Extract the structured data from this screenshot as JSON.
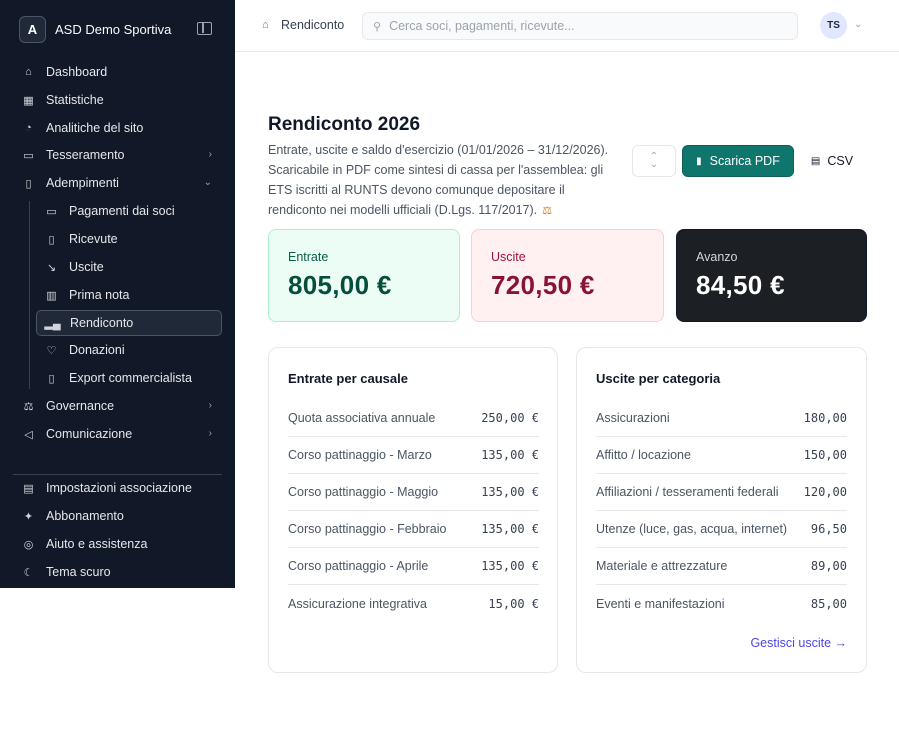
{
  "sidebar": {
    "brand_initial": "A",
    "brand_name": "ASD Demo Sportiva",
    "items": [
      {
        "label": "Dashboard",
        "icon": "home-icon"
      },
      {
        "label": "Statistiche",
        "icon": "chart-icon"
      },
      {
        "label": "Analitiche del sito",
        "icon": "globe-icon"
      },
      {
        "label": "Tesseramento",
        "icon": "id-card-icon"
      },
      {
        "label": "Adempimenti",
        "icon": "document-icon"
      }
    ],
    "sub_items": [
      {
        "label": "Pagamenti dai soci",
        "icon": "credit-card-icon"
      },
      {
        "label": "Ricevute",
        "icon": "receipt-icon"
      },
      {
        "label": "Uscite",
        "icon": "trending-down-icon"
      },
      {
        "label": "Prima nota",
        "icon": "book-icon"
      },
      {
        "label": "Rendiconto",
        "icon": "bar-chart-icon"
      },
      {
        "label": "Donazioni",
        "icon": "heart-icon"
      },
      {
        "label": "Export commercialista",
        "icon": "file-export-icon"
      }
    ],
    "items2": [
      {
        "label": "Governance",
        "icon": "scale-icon"
      },
      {
        "label": "Comunicazione",
        "icon": "megaphone-icon"
      }
    ],
    "footer_items": [
      {
        "label": "Impostazioni associazione",
        "icon": "building-icon"
      },
      {
        "label": "Abbonamento",
        "icon": "sparkle-icon"
      },
      {
        "label": "Aiuto e assistenza",
        "icon": "lifebuoy-icon"
      },
      {
        "label": "Tema scuro",
        "icon": "moon-icon"
      }
    ]
  },
  "topbar": {
    "breadcrumb": "Rendiconto",
    "search_placeholder": "Cerca soci, pagamenti, ricevute...",
    "avatar_initials": "TS"
  },
  "page": {
    "title": "Rendiconto 2026",
    "description": "Entrate, uscite e saldo d'esercizio (01/01/2026 – 31/12/2026). Scaricabile in PDF come sintesi di cassa per l'assemblea: gli ETS iscritti al RUNTS devono comunque depositare il rendiconto nei modelli ufficiali (D.Lgs. 117/2017).",
    "pdf_label": "Scarica PDF",
    "csv_label": "CSV"
  },
  "kpis": {
    "in_label": "Entrate",
    "in_value": "805,00 €",
    "out_label": "Uscite",
    "out_value": "720,50 €",
    "bal_label": "Avanzo",
    "bal_value": "84,50 €"
  },
  "income": {
    "title": "Entrate per causale",
    "rows": [
      {
        "label": "Quota associativa annuale",
        "amount": "250,00 €"
      },
      {
        "label": "Corso pattinaggio - Marzo",
        "amount": "135,00 €"
      },
      {
        "label": "Corso pattinaggio - Maggio",
        "amount": "135,00 €"
      },
      {
        "label": "Corso pattinaggio - Febbraio",
        "amount": "135,00 €"
      },
      {
        "label": "Corso pattinaggio - Aprile",
        "amount": "135,00 €"
      },
      {
        "label": "Assicurazione integrativa",
        "amount": "15,00 €"
      }
    ]
  },
  "expenses": {
    "title": "Uscite per categoria",
    "rows": [
      {
        "label": "Assicurazioni",
        "amount": "180,00"
      },
      {
        "label": "Affitto / locazione",
        "amount": "150,00"
      },
      {
        "label": "Affiliazioni / tesseramenti federali",
        "amount": "120,00"
      },
      {
        "label": "Utenze (luce, gas, acqua, internet)",
        "amount": "96,50"
      },
      {
        "label": "Materiale e attrezzature",
        "amount": "89,00"
      },
      {
        "label": "Eventi e manifestazioni",
        "amount": "85,00"
      }
    ],
    "link": "Gestisci uscite →"
  }
}
